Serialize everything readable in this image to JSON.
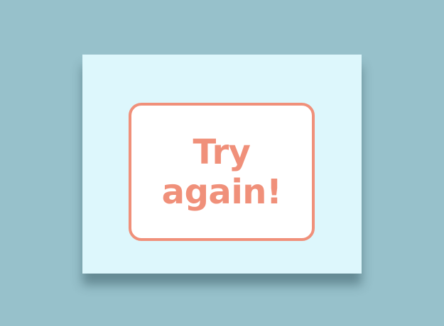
{
  "colors": {
    "background": "#97c1cb",
    "card": "#ddf7fc",
    "accent": "#f0907a",
    "button_fill": "#ffffff"
  },
  "dialog": {
    "retry_button": {
      "line1": "Try",
      "line2": "again!"
    }
  }
}
